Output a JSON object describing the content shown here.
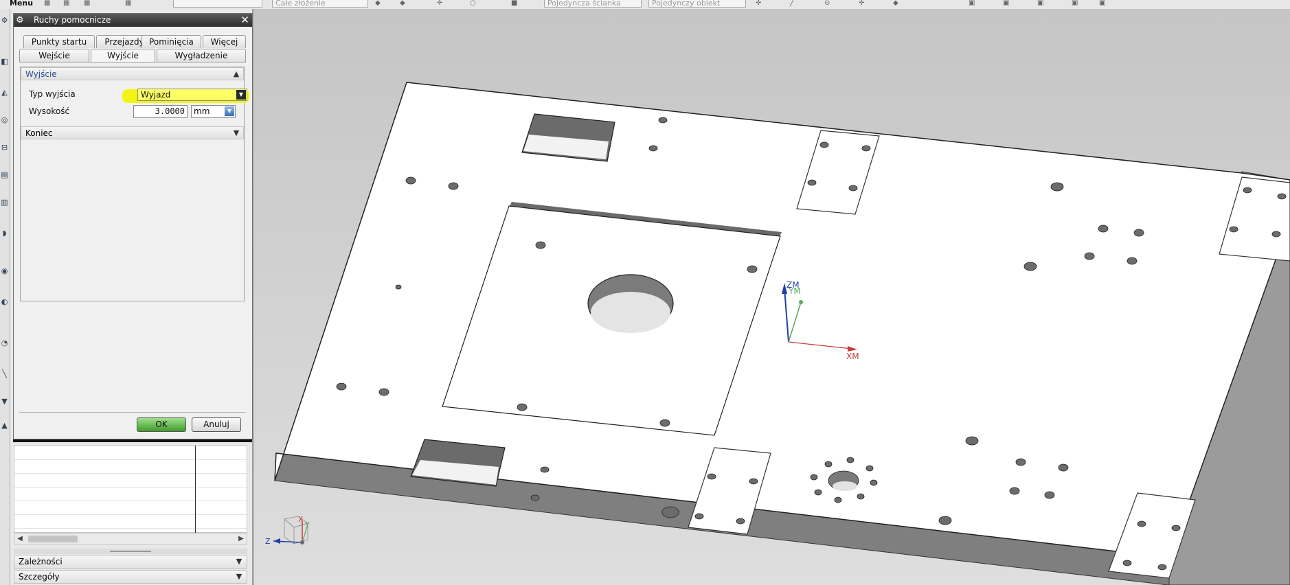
{
  "toolbar": {
    "menu_label": "Menu",
    "filter_assembly": "Całe złożenie",
    "filter_face": "Pojedyncza ścianka",
    "filter_object": "Pojedynczy obiekt"
  },
  "dialog": {
    "title": "Ruchy pomocnicze",
    "tabs_row1": [
      "Punkty startu",
      "Przejazdy",
      "Pominięcia",
      "Więcej"
    ],
    "tabs_row2": [
      "Wejście",
      "Wyjście",
      "Wygładzenie"
    ],
    "active_tab": "Wyjście",
    "section_exit": {
      "header": "Wyjście",
      "exit_type_label": "Typ wyjścia",
      "exit_type_value": "Wyjazd",
      "height_label": "Wysokość",
      "height_value": "3.0000",
      "height_unit": "mm"
    },
    "section_end_header": "Koniec",
    "ok_label": "OK",
    "cancel_label": "Anuluj"
  },
  "navigator": {
    "panels": [
      "Zależności",
      "Szczegóły"
    ]
  },
  "viewport": {
    "wcs_labels": {
      "zm": "ZM",
      "ym": "YM",
      "xm": "XM"
    },
    "triad_labels": {
      "z": "Z",
      "x": "X",
      "y": "Y"
    },
    "colors": {
      "highlight": "#f4f414",
      "z_axis": "#1f3fa8",
      "y_axis": "#5aa85a",
      "x_axis": "#c83c3c"
    }
  }
}
